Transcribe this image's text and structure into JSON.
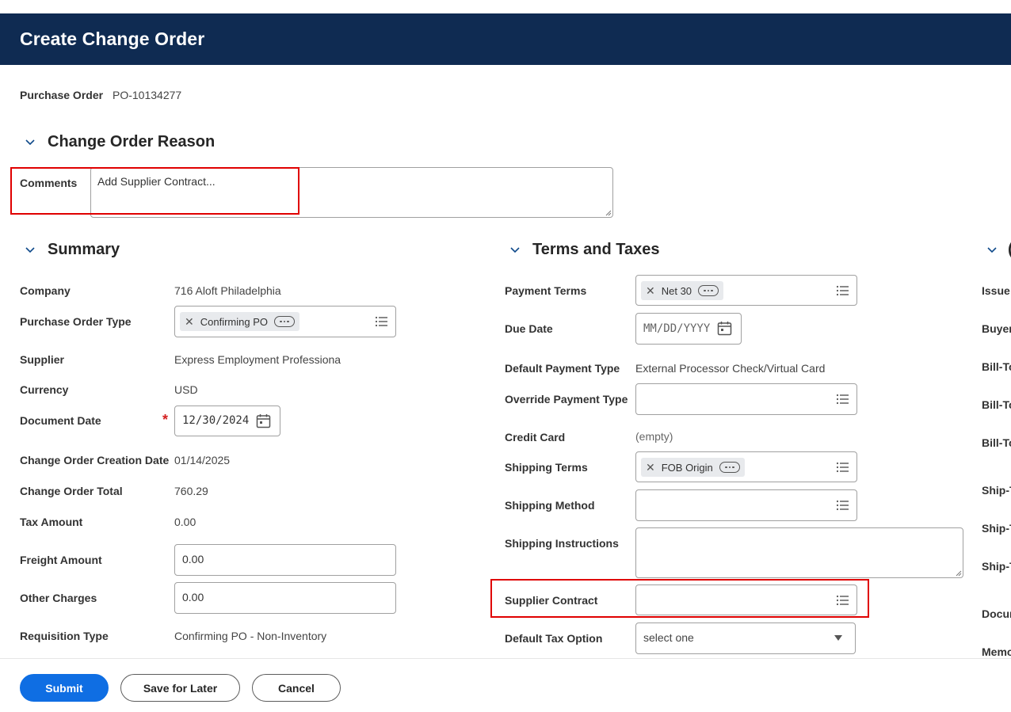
{
  "header": {
    "title": "Create Change Order"
  },
  "purchase_order": {
    "label": "Purchase Order",
    "value": "PO-10134277"
  },
  "change_order_reason": {
    "section_title": "Change Order Reason",
    "comments_label": "Comments",
    "comments_value": "Add Supplier Contract..."
  },
  "summary": {
    "section_title": "Summary",
    "company": {
      "label": "Company",
      "value": "716 Aloft Philadelphia"
    },
    "po_type": {
      "label": "Purchase Order Type",
      "pill": "Confirming PO"
    },
    "supplier": {
      "label": "Supplier",
      "value": "Express Employment Professiona"
    },
    "currency": {
      "label": "Currency",
      "value": "USD"
    },
    "document_date": {
      "label": "Document Date",
      "required_mark": "*",
      "value": "12/30/2024"
    },
    "creation_date": {
      "label": "Change Order Creation Date",
      "value": "01/14/2025"
    },
    "total": {
      "label": "Change Order Total",
      "value": "760.29"
    },
    "tax": {
      "label": "Tax Amount",
      "value": "0.00"
    },
    "freight": {
      "label": "Freight Amount",
      "value": "0.00"
    },
    "other": {
      "label": "Other Charges",
      "value": "0.00"
    },
    "requisition_type": {
      "label": "Requisition Type",
      "value": "Confirming PO - Non-Inventory"
    }
  },
  "terms": {
    "section_title": "Terms and Taxes",
    "payment_terms": {
      "label": "Payment Terms",
      "pill": "Net 30"
    },
    "due_date": {
      "label": "Due Date",
      "placeholder": "MM/DD/YYYY"
    },
    "default_payment_type": {
      "label": "Default Payment Type",
      "value": "External Processor Check/Virtual Card"
    },
    "override_payment_type": {
      "label": "Override Payment Type"
    },
    "credit_card": {
      "label": "Credit Card",
      "value": "(empty)"
    },
    "shipping_terms": {
      "label": "Shipping Terms",
      "pill": "FOB Origin"
    },
    "shipping_method": {
      "label": "Shipping Method"
    },
    "shipping_instructions": {
      "label": "Shipping Instructions"
    },
    "supplier_contract": {
      "label": "Supplier Contract"
    },
    "default_tax_option": {
      "label": "Default Tax Option",
      "value": "select one"
    }
  },
  "third_column": {
    "labels": [
      "Issue",
      "Buyer",
      "Bill-To",
      "Bill-To",
      "Bill-To",
      "Ship-T",
      "Ship-T",
      "Ship-T",
      "Docum",
      "Memo"
    ]
  },
  "footer": {
    "submit": "Submit",
    "save_later": "Save for Later",
    "cancel": "Cancel"
  },
  "colors": {
    "header_bg": "#0f2b52",
    "primary_button": "#0f6ee3",
    "highlight_red": "#e00000"
  }
}
